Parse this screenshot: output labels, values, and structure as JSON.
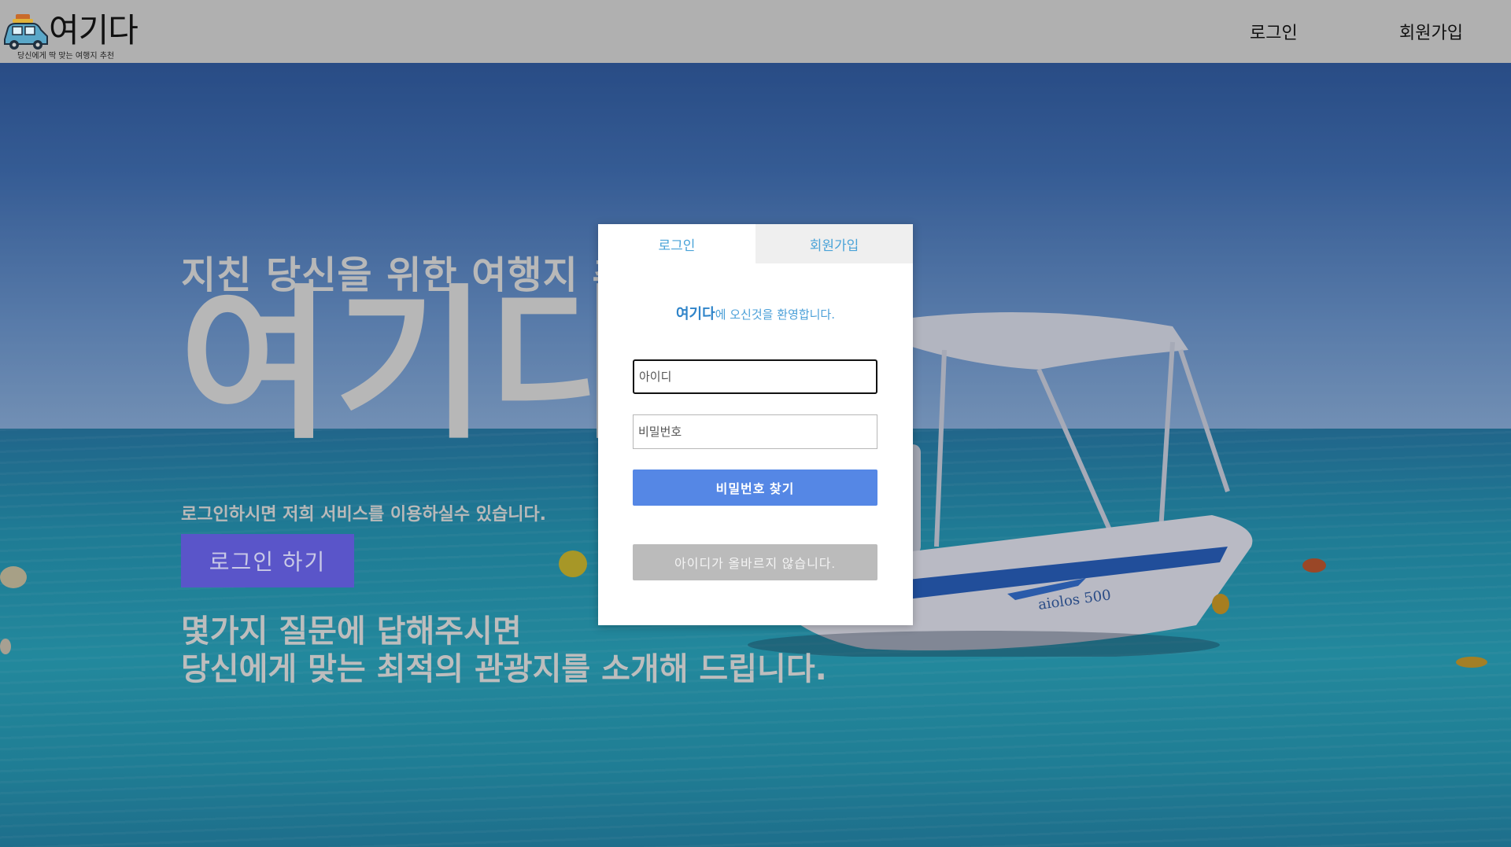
{
  "header": {
    "logo_title": "여기다",
    "logo_subtitle": "당신에게 딱 맞는 여행지 추천",
    "nav": [
      {
        "label": "로그인"
      },
      {
        "label": "회원가입"
      }
    ]
  },
  "hero": {
    "tagline": "지친 당신을 위한 여행지 추천",
    "big_title": "여기다",
    "service_text": "로그인하시면 저희 서비스를 이용하실수 있습니다.",
    "login_button": "로그인 하기",
    "question_line1": "몇가지 질문에 답해주시면",
    "question_line2": "당신에게 맞는 최적의 관광지를 소개해 드립니다."
  },
  "modal": {
    "tabs": [
      {
        "label": "로그인"
      },
      {
        "label": "회원가입"
      }
    ],
    "welcome_brand": "여기다",
    "welcome_rest": "에 오신것을 환영합니다.",
    "id_placeholder": "아이디",
    "pw_placeholder": "비밀번호",
    "find_password_button": "비밀번호 찾기",
    "error_message": "아이디가 올바르지 않습니다."
  },
  "colors": {
    "header_bg": "#b0b0b0",
    "hero_button": "#5a55c9",
    "primary_button": "#5587e5",
    "accent_text": "#4a9fd8",
    "error_button": "#bbbbbb"
  },
  "icons": {
    "logo": "car-with-luggage-icon"
  }
}
